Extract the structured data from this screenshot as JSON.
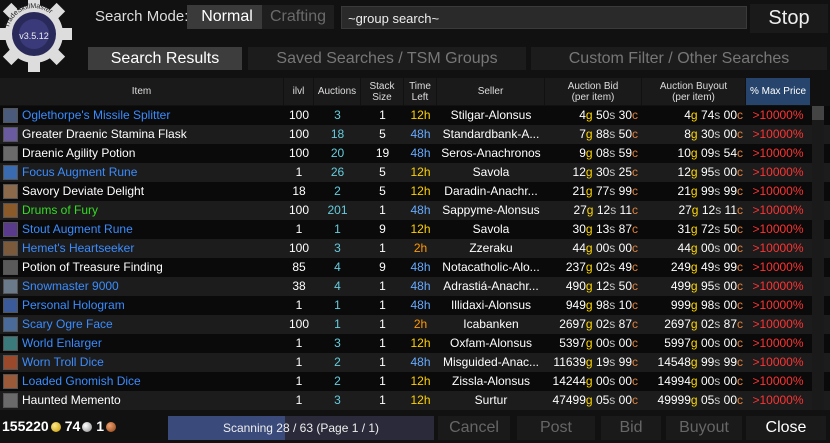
{
  "logo": {
    "text": "TradeSkillMaster",
    "version": "v3.5.12"
  },
  "header": {
    "search_mode_label": "Search Mode:",
    "mode_normal": "Normal",
    "mode_crafting": "Crafting",
    "search_value": "~group search~",
    "stop_label": "Stop"
  },
  "tabs": {
    "results": "Search Results",
    "saved": "Saved Searches / TSM Groups",
    "custom": "Custom Filter / Other Searches"
  },
  "columns": {
    "item": "Item",
    "ilvl": "ilvl",
    "auctions": "Auctions",
    "stack1": "Stack",
    "stack2": "Size",
    "time1": "Time",
    "time2": "Left",
    "seller": "Seller",
    "bid1": "Auction Bid",
    "bid2": "(per item)",
    "buyout1": "Auction Buyout",
    "buyout2": "(per item)",
    "pct": "% Max Price"
  },
  "rows": [
    {
      "item": "Oglethorpe's Missile Splitter",
      "color": "#3b8cff",
      "icon": "#4a5a7a",
      "ilvl": "100",
      "auctions": "3",
      "stack": "1",
      "time": "12h",
      "seller": "Stilgar-Alonsus",
      "bid": [
        "4",
        "50",
        "30"
      ],
      "buyout": [
        "4",
        "74",
        "00"
      ],
      "pct": ">10000%"
    },
    {
      "item": "Greater Draenic Stamina Flask",
      "color": "#ffffff",
      "icon": "#6a5aa0",
      "ilvl": "100",
      "auctions": "18",
      "stack": "5",
      "time": "48h",
      "seller": "Standardbank-A...",
      "bid": [
        "7",
        "88",
        "50"
      ],
      "buyout": [
        "8",
        "30",
        "00"
      ],
      "pct": ">10000%"
    },
    {
      "item": "Draenic Agility Potion",
      "color": "#ffffff",
      "icon": "#6a6a6a",
      "ilvl": "100",
      "auctions": "20",
      "stack": "19",
      "time": "48h",
      "seller": "Seros-Anachronos",
      "bid": [
        "9",
        "08",
        "59"
      ],
      "buyout": [
        "10",
        "09",
        "54"
      ],
      "pct": ">10000%"
    },
    {
      "item": "Focus Augment Rune",
      "color": "#3b8cff",
      "icon": "#3a6ab0",
      "ilvl": "1",
      "auctions": "26",
      "stack": "5",
      "time": "12h",
      "seller": "Savola",
      "bid": [
        "12",
        "30",
        "25"
      ],
      "buyout": [
        "12",
        "95",
        "00"
      ],
      "pct": ">10000%"
    },
    {
      "item": "Savory Deviate Delight",
      "color": "#ffffff",
      "icon": "#8a6a4a",
      "ilvl": "18",
      "auctions": "2",
      "stack": "5",
      "time": "12h",
      "seller": "Daradin-Anachr...",
      "bid": [
        "21",
        "77",
        "99"
      ],
      "buyout": [
        "21",
        "99",
        "99"
      ],
      "pct": ">10000%"
    },
    {
      "item": "Drums of Fury",
      "color": "#33dd22",
      "icon": "#8a5a2a",
      "ilvl": "100",
      "auctions": "201",
      "stack": "1",
      "time": "48h",
      "seller": "Sappyme-Alonsus",
      "bid": [
        "27",
        "12",
        "11"
      ],
      "buyout": [
        "27",
        "12",
        "11"
      ],
      "pct": ">10000%"
    },
    {
      "item": "Stout Augment Rune",
      "color": "#3b8cff",
      "icon": "#5a3a8a",
      "ilvl": "1",
      "auctions": "1",
      "stack": "9",
      "time": "12h",
      "seller": "Savola",
      "bid": [
        "30",
        "13",
        "87"
      ],
      "buyout": [
        "31",
        "72",
        "50"
      ],
      "pct": ">10000%"
    },
    {
      "item": "Hemet's Heartseeker",
      "color": "#3b8cff",
      "icon": "#7a5a3a",
      "ilvl": "100",
      "auctions": "3",
      "stack": "1",
      "time": "2h",
      "seller": "Zzeraku",
      "bid": [
        "44",
        "00",
        "00"
      ],
      "buyout": [
        "44",
        "00",
        "00"
      ],
      "pct": ">10000%"
    },
    {
      "item": "Potion of Treasure Finding",
      "color": "#ffffff",
      "icon": "#5a5a5a",
      "ilvl": "85",
      "auctions": "4",
      "stack": "9",
      "time": "48h",
      "seller": "Notacatholic-Alo...",
      "bid": [
        "237",
        "02",
        "49"
      ],
      "buyout": [
        "249",
        "49",
        "99"
      ],
      "pct": ">10000%"
    },
    {
      "item": "Snowmaster 9000",
      "color": "#3b8cff",
      "icon": "#6a7a8a",
      "ilvl": "38",
      "auctions": "4",
      "stack": "1",
      "time": "48h",
      "seller": "Adrastiá-Anachr...",
      "bid": [
        "490",
        "12",
        "50"
      ],
      "buyout": [
        "499",
        "95",
        "00"
      ],
      "pct": ">10000%"
    },
    {
      "item": "Personal Hologram",
      "color": "#3b8cff",
      "icon": "#3a5a9a",
      "ilvl": "1",
      "auctions": "1",
      "stack": "1",
      "time": "48h",
      "seller": "Illidaxi-Alonsus",
      "bid": [
        "949",
        "98",
        "10"
      ],
      "buyout": [
        "999",
        "98",
        "00"
      ],
      "pct": ">10000%"
    },
    {
      "item": "Scary Ogre Face",
      "color": "#3b8cff",
      "icon": "#4a6a9a",
      "ilvl": "100",
      "auctions": "1",
      "stack": "1",
      "time": "2h",
      "seller": "Icabanken",
      "bid": [
        "2697",
        "02",
        "87"
      ],
      "buyout": [
        "2697",
        "02",
        "87"
      ],
      "pct": ">10000%"
    },
    {
      "item": "World Enlarger",
      "color": "#3b8cff",
      "icon": "#3a7a7a",
      "ilvl": "1",
      "auctions": "3",
      "stack": "1",
      "time": "12h",
      "seller": "Oxfam-Alonsus",
      "bid": [
        "5397",
        "00",
        "00"
      ],
      "buyout": [
        "5997",
        "00",
        "00"
      ],
      "pct": ">10000%"
    },
    {
      "item": "Worn Troll Dice",
      "color": "#3b8cff",
      "icon": "#9a4a2a",
      "ilvl": "1",
      "auctions": "2",
      "stack": "1",
      "time": "48h",
      "seller": "Misguided-Anac...",
      "bid": [
        "11639",
        "19",
        "99"
      ],
      "buyout": [
        "14548",
        "99",
        "99"
      ],
      "pct": ">10000%"
    },
    {
      "item": "Loaded Gnomish Dice",
      "color": "#3b8cff",
      "icon": "#9a5a3a",
      "ilvl": "1",
      "auctions": "2",
      "stack": "1",
      "time": "12h",
      "seller": "Zissla-Alonsus",
      "bid": [
        "14244",
        "00",
        "00"
      ],
      "buyout": [
        "14994",
        "00",
        "00"
      ],
      "pct": ">10000%"
    },
    {
      "item": "Haunted Memento",
      "color": "#ffffff",
      "icon": "#6a6a6a",
      "ilvl": "1",
      "auctions": "3",
      "stack": "1",
      "time": "12h",
      "seller": "Surtur",
      "bid": [
        "47499",
        "05",
        "00"
      ],
      "buyout": [
        "49999",
        "05",
        "00"
      ],
      "pct": ">10000%"
    }
  ],
  "footer": {
    "gold": "155220",
    "silver": "74",
    "copper": "1",
    "scan_text": "Scanning 28 / 63 (Page 1 / 1)",
    "scan_progress": 0.44,
    "cancel": "Cancel",
    "post": "Post",
    "bid": "Bid",
    "buyout": "Buyout",
    "close": "Close"
  }
}
